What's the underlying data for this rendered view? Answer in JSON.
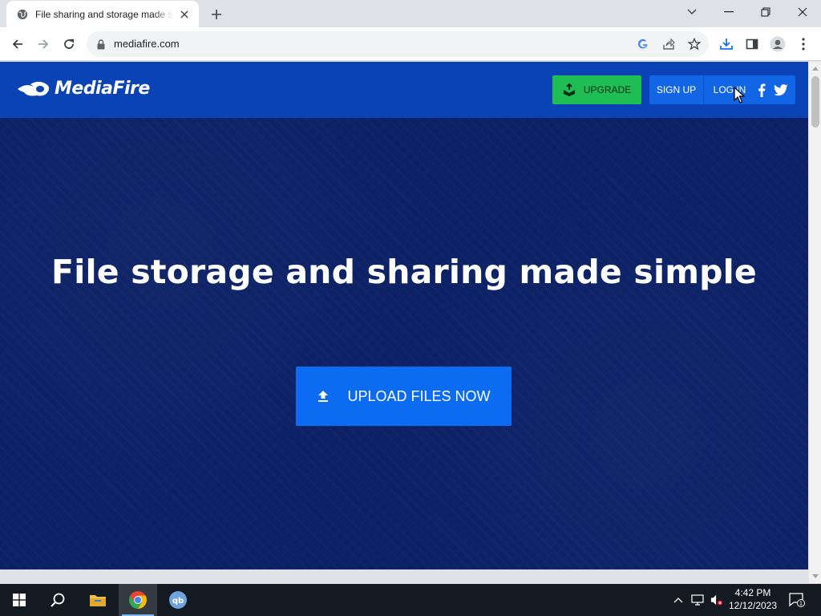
{
  "browser": {
    "tab": {
      "title": "File sharing and storage made simple",
      "favicon": "globe-icon"
    },
    "address": {
      "url": "mediafire.com"
    }
  },
  "site": {
    "logo_text": "MediaFire",
    "nav": {
      "upgrade_label": "UPGRADE",
      "signup_label": "SIGN UP",
      "login_label": "LOG IN"
    },
    "hero": {
      "title": "File storage and sharing made simple",
      "upload_label": "UPLOAD FILES NOW"
    }
  },
  "taskbar": {
    "time": "4:42 PM",
    "date": "12/12/2023",
    "notification_count": "1"
  },
  "colors": {
    "header_blue": "#0a43b5",
    "hero_navy": "#0c2166",
    "upgrade_green": "#1fbe54",
    "upload_blue": "#0b6cf2"
  }
}
